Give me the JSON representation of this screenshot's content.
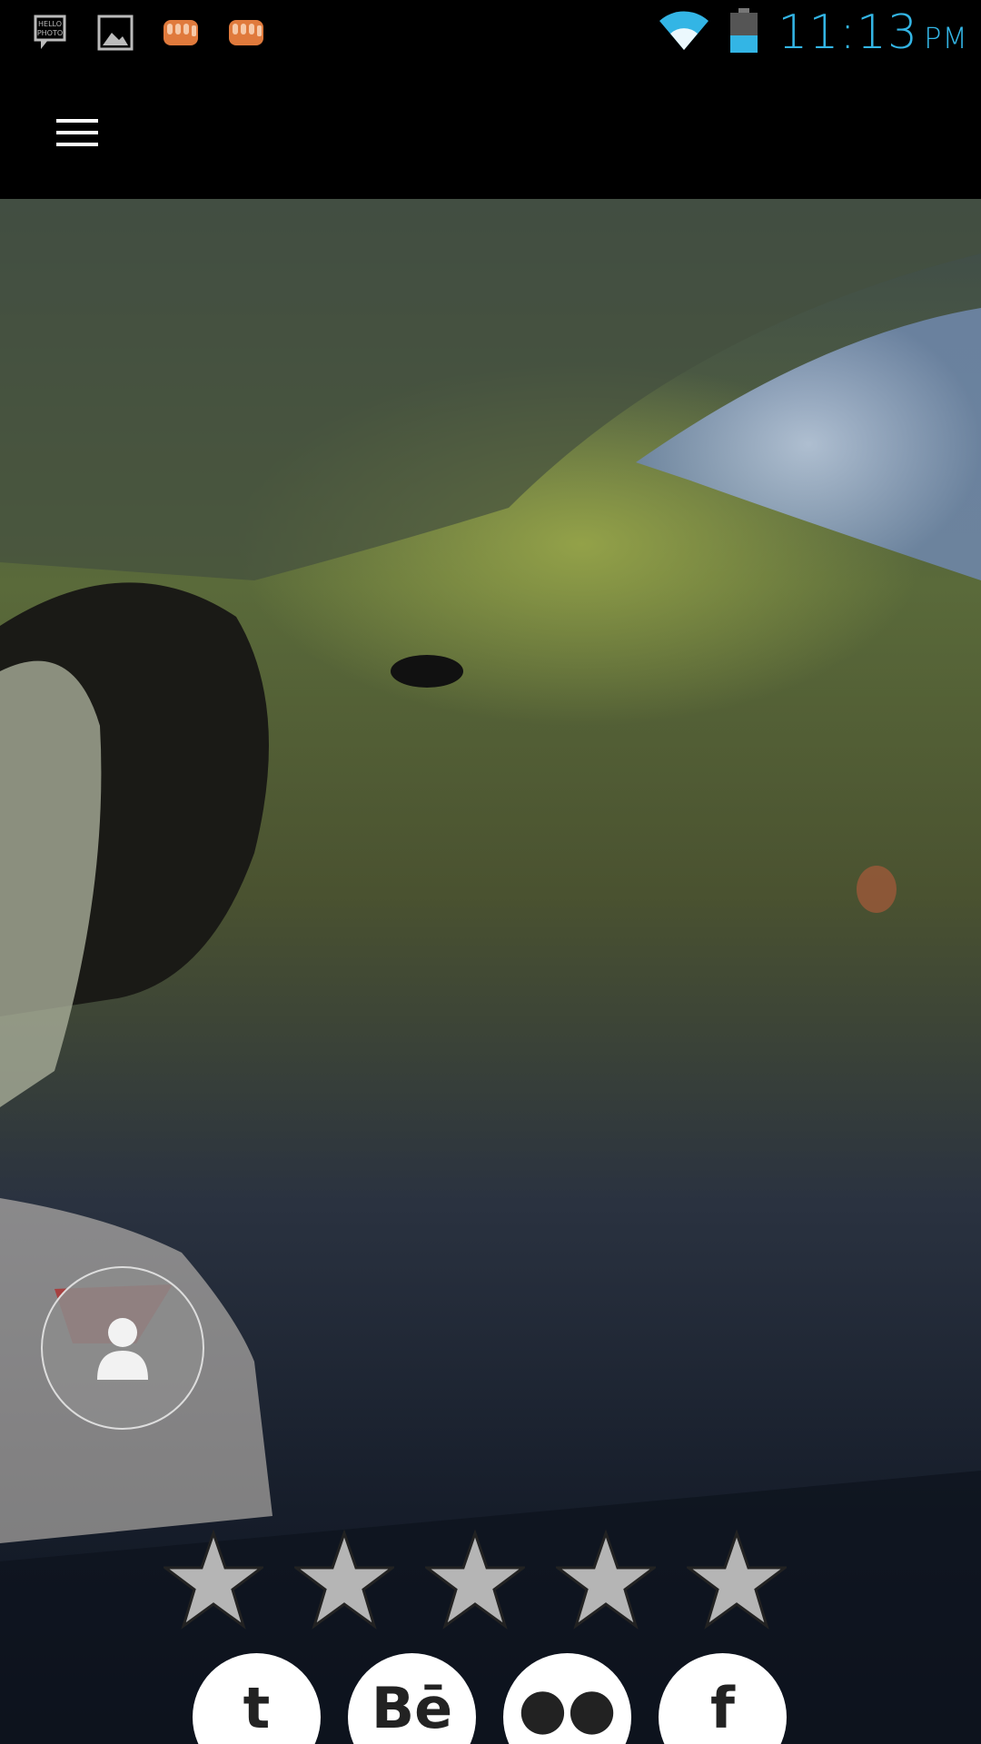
{
  "status_bar": {
    "time": "11:13",
    "ampm": "PM",
    "notification_icons": [
      "hello-photo-icon",
      "gallery-icon",
      "fist-icon",
      "fist-icon"
    ],
    "system_icons": [
      "wifi-icon",
      "battery-icon"
    ],
    "accent_color": "#33b5e5"
  },
  "app_bar": {
    "menu_icon": "hamburger-menu-icon"
  },
  "profile": {
    "avatar_icon": "person-icon",
    "rating": {
      "filled": 0,
      "total": 5
    }
  },
  "social_links": [
    {
      "icon": "twitter-icon",
      "glyph": "t"
    },
    {
      "icon": "behance-icon",
      "glyph": "Bē"
    },
    {
      "icon": "flickr-icon",
      "glyph": "●●"
    },
    {
      "icon": "facebook-icon",
      "glyph": "f"
    }
  ]
}
